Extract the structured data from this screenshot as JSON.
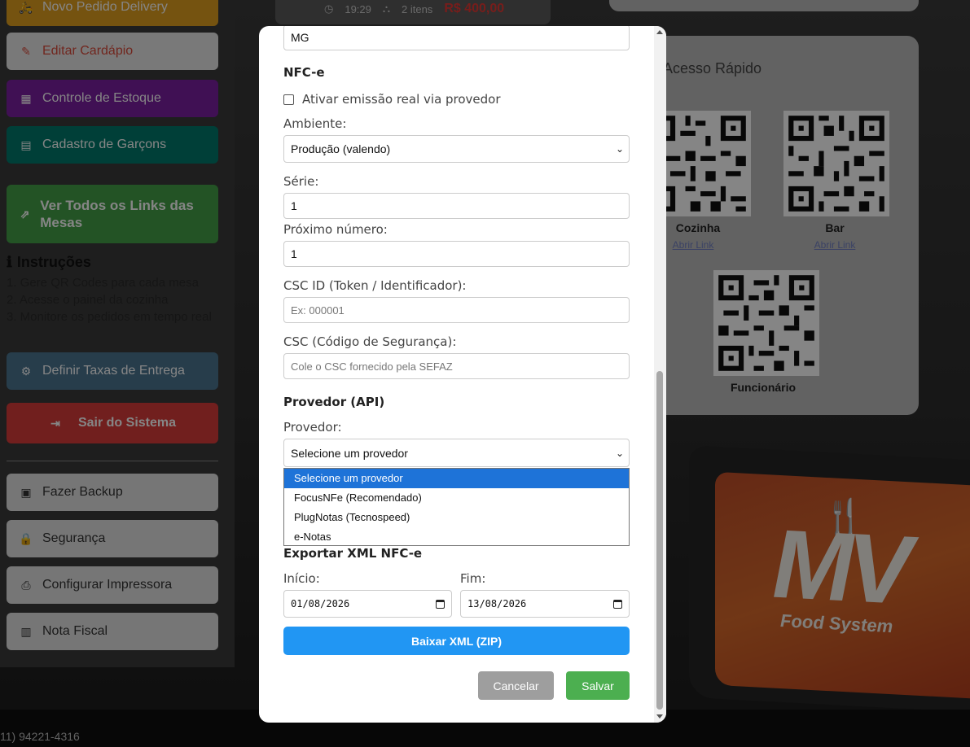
{
  "background": {
    "sidebar": {
      "buttons": [
        {
          "label": "Novo Pedido Delivery",
          "icon": "motorcycle-icon"
        },
        {
          "label": "Editar Cardápio",
          "icon": "edit-icon"
        },
        {
          "label": "Controle de Estoque",
          "icon": "boxes-icon"
        },
        {
          "label": "Cadastro de Garçons",
          "icon": "id-card-icon"
        },
        {
          "label": "Ver Todos os Links das Mesas",
          "icon": "external-link-icon"
        },
        {
          "label": "Definir Taxas de Entrega",
          "icon": "gear-icon"
        },
        {
          "label": "Sair do Sistema",
          "icon": "logout-icon"
        },
        {
          "label": "Fazer Backup",
          "icon": "save-icon"
        },
        {
          "label": "Segurança",
          "icon": "lock-icon"
        },
        {
          "label": "Configurar Impressora",
          "icon": "printer-icon"
        },
        {
          "label": "Nota Fiscal",
          "icon": "receipt-icon"
        }
      ],
      "instructions": {
        "title": "Instruções",
        "steps": [
          "1. Gere QR Codes para cada mesa",
          "2. Acesse o painel da cozinha",
          "3. Monitore os pedidos em tempo real"
        ]
      }
    },
    "order_card": {
      "time": "19:29",
      "items": "2 itens",
      "price": "R$ 400,00"
    },
    "quick_access": {
      "title": "Acesso Rápido",
      "qrs": [
        {
          "label": "Cozinha",
          "link": "Abrir Link"
        },
        {
          "label": "Bar",
          "link": "Abrir Link"
        },
        {
          "label": "Funcionário",
          "link": ""
        }
      ]
    },
    "branding": {
      "mark": "MV",
      "text": "Food System"
    },
    "footer_phone": "11) 94221-4316"
  },
  "modal": {
    "uf_value": "MG",
    "nfce": {
      "title": "NFC-e",
      "checkbox_label": "Ativar emissão real via provedor",
      "checkbox_checked": false,
      "ambiente_label": "Ambiente:",
      "ambiente_value": "Produção (valendo)",
      "serie_label": "Série:",
      "serie_value": "1",
      "proximo_label": "Próximo número:",
      "proximo_value": "1",
      "csc_id_label": "CSC ID (Token / Identificador):",
      "csc_id_placeholder": "Ex: 000001",
      "csc_label": "CSC (Código de Segurança):",
      "csc_placeholder": "Cole o CSC fornecido pela SEFAZ"
    },
    "provider": {
      "title": "Provedor (API)",
      "label": "Provedor:",
      "value": "Selecione um provedor",
      "options": [
        "Selecione um provedor",
        "FocusNFe (Recomendado)",
        "PlugNotas (Tecnospeed)",
        "e-Notas"
      ]
    },
    "export": {
      "title": "Exportar XML NFC-e",
      "start_label": "Início:",
      "start_value": "01/08/2026",
      "end_label": "Fim:",
      "end_value": "13/08/2026",
      "download_label": "Baixar XML (ZIP)"
    },
    "actions": {
      "cancel": "Cancelar",
      "save": "Salvar"
    }
  }
}
